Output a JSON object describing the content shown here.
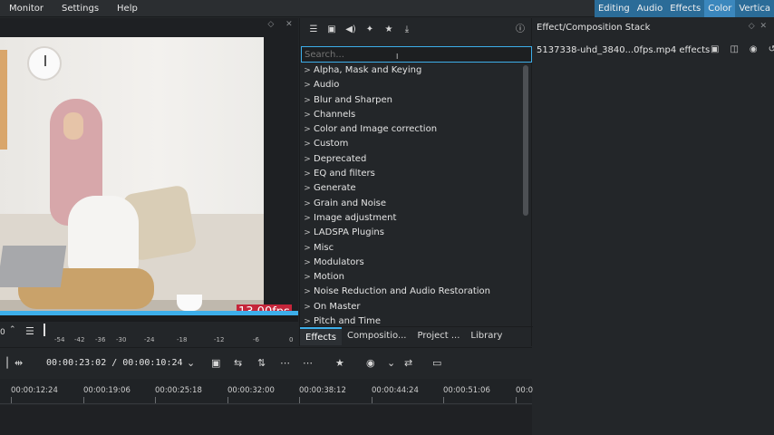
{
  "menu": {
    "items": [
      "Monitor",
      "Settings",
      "Help"
    ]
  },
  "workspaces": {
    "tabs": [
      "Editing",
      "Audio",
      "Effects",
      "Color",
      "Vertica"
    ],
    "active": "Color"
  },
  "monitor": {
    "fps_label": "13.00fps",
    "meter_zero": "0",
    "meter_scale": [
      "-54",
      "-42",
      "-36",
      "-30",
      "-24",
      "-18",
      "-12",
      "-6",
      "0"
    ]
  },
  "effects_panel": {
    "search_placeholder": "Search...",
    "categories": [
      "Alpha, Mask and Keying",
      "Audio",
      "Blur and Sharpen",
      "Channels",
      "Color and Image correction",
      "Custom",
      "Deprecated",
      "EQ and filters",
      "Generate",
      "Grain and Noise",
      "Image adjustment",
      "LADSPA Plugins",
      "Misc",
      "Modulators",
      "Motion",
      "Noise Reduction and Audio Restoration",
      "On Master",
      "Pitch and Time"
    ],
    "tabs": [
      "Effects",
      "Compositio...",
      "Project ...",
      "Library"
    ],
    "active_tab": "Effects"
  },
  "stack_panel": {
    "title": "Effect/Composition Stack",
    "file_label": "5137338-uhd_3840...0fps.mp4 effects"
  },
  "timeline": {
    "timecode": "00:00:23:02 / 00:00:10:24",
    "ruler": [
      "00:00:12:24",
      "00:00:19:06",
      "00:00:25:18",
      "00:00:32:00",
      "00:00:38:12",
      "00:00:44:24",
      "00:00:51:06",
      "00:0"
    ]
  },
  "colors": {
    "accent": "#3daee9",
    "fps_badge": "#c5253a",
    "workspace_bar": "#2b6c98"
  }
}
